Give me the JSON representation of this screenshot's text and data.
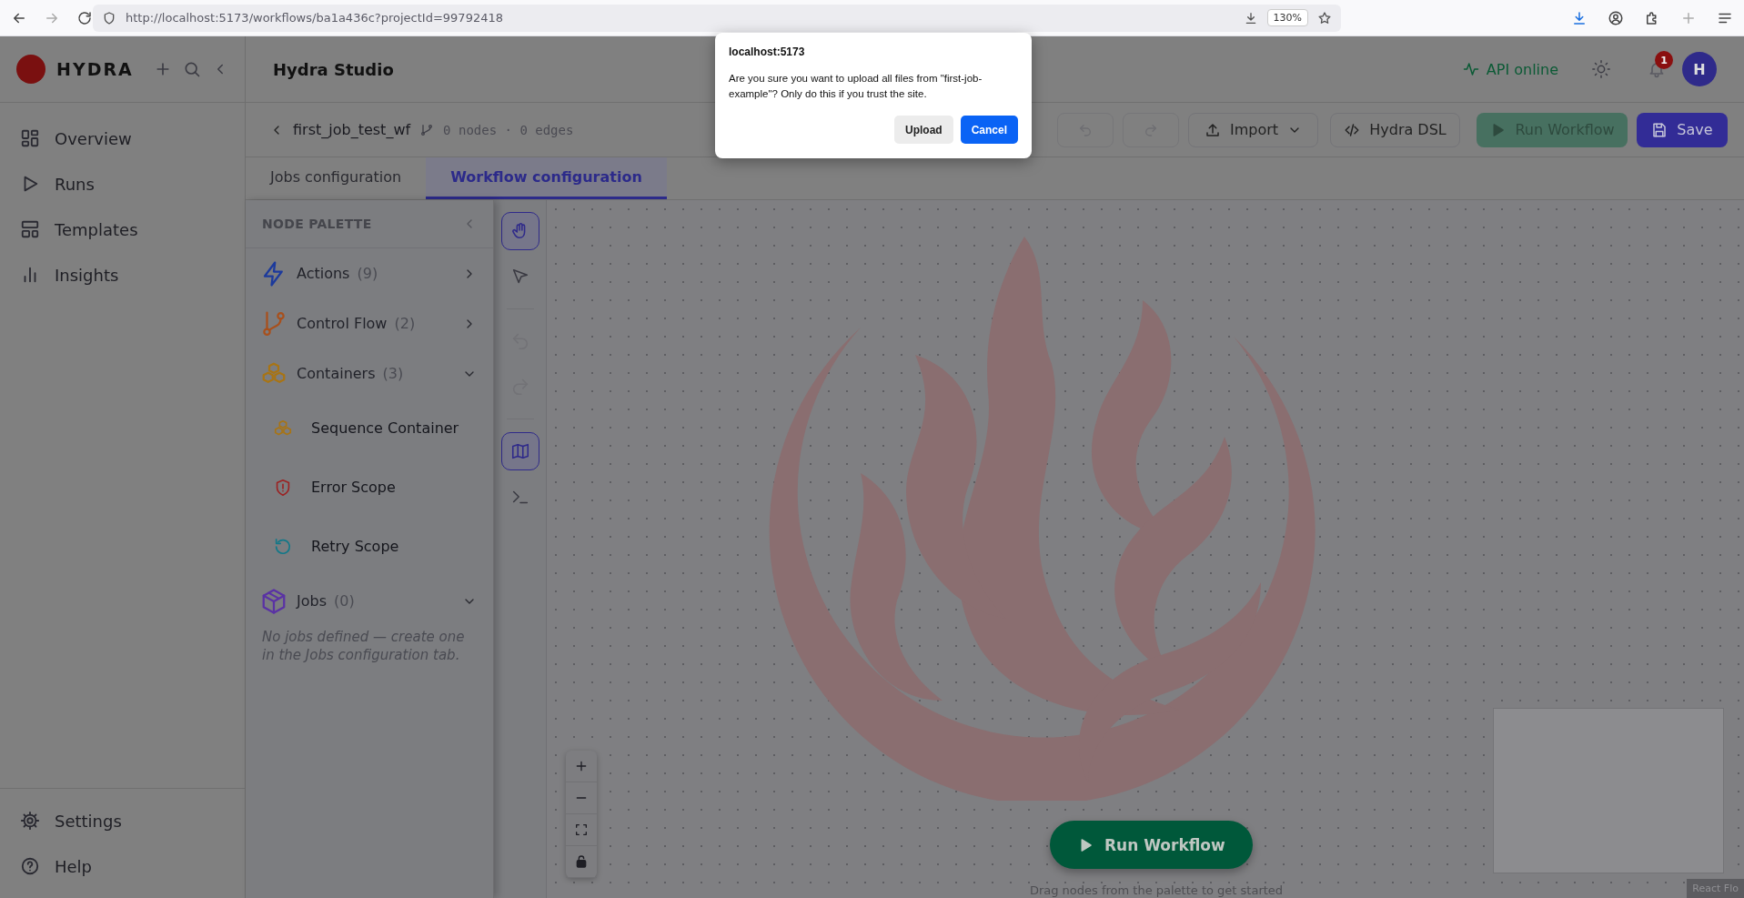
{
  "browser": {
    "url": "http://localhost:5173/workflows/ba1a436c?projectId=99792418",
    "zoom": "130%"
  },
  "sidebar": {
    "brand": "HYDRA",
    "items": [
      {
        "label": "Overview",
        "kind": "overview",
        "selected": false
      },
      {
        "label": "Runs",
        "kind": "runs",
        "selected": false
      },
      {
        "label": "Templates",
        "kind": "templates",
        "selected": false
      },
      {
        "label": "Insights",
        "kind": "insights",
        "selected": false
      }
    ],
    "footer": [
      {
        "label": "Settings",
        "kind": "settings"
      },
      {
        "label": "Help",
        "kind": "help"
      }
    ]
  },
  "header": {
    "title": "Hydra Studio",
    "api_status": "API online",
    "notifications": "1",
    "avatar": "H"
  },
  "workflow": {
    "name": "first_job_test_wf",
    "stats": "0 nodes · 0 edges",
    "history": [
      {
        "kind": "undo",
        "disabled": true
      },
      {
        "kind": "redo",
        "disabled": true
      }
    ],
    "import": "Import",
    "dsl": "Hydra DSL",
    "run": "Run Workflow",
    "save": "Save"
  },
  "tabs": [
    {
      "label": "Jobs configuration",
      "selected": false
    },
    {
      "label": "Workflow configuration",
      "selected": true
    }
  ],
  "palette": {
    "title": "NODE PALETTE",
    "groups": [
      {
        "label": "Actions",
        "count": "(9)",
        "kind": "actions",
        "expanded": false
      },
      {
        "label": "Control Flow",
        "count": "(2)",
        "kind": "flow",
        "expanded": false
      },
      {
        "label": "Containers",
        "count": "(3)",
        "kind": "containers",
        "expanded": true,
        "children": [
          {
            "label": "Sequence Container",
            "kind": "sequence"
          },
          {
            "label": "Error Scope",
            "kind": "error"
          },
          {
            "label": "Retry Scope",
            "kind": "retry"
          }
        ]
      },
      {
        "label": "Jobs",
        "count": "(0)",
        "kind": "jobs",
        "expanded": true,
        "note": "No jobs defined — create one in the Jobs configuration tab."
      }
    ]
  },
  "tools": [
    {
      "kind": "hand",
      "selected": true,
      "disabled": false
    },
    {
      "kind": "pointer",
      "selected": false,
      "disabled": false
    },
    {
      "kind": "undo",
      "selected": false,
      "disabled": true
    },
    {
      "kind": "redo",
      "selected": false,
      "disabled": true
    },
    {
      "kind": "map",
      "selected": true,
      "disabled": false
    },
    {
      "kind": "terminal",
      "selected": false,
      "disabled": false
    }
  ],
  "canvas": {
    "run": "Run Workflow",
    "hint": "Drag nodes from the palette to get started",
    "attribution": "React Flo"
  },
  "dialog": {
    "origin": "localhost:5173",
    "message": "Are you sure you want to upload all files from \"first-job-example\"? Only do this if you trust the site.",
    "buttons": [
      {
        "label": "Upload",
        "kind": "secondary"
      },
      {
        "label": "Cancel",
        "kind": "primary"
      }
    ]
  }
}
